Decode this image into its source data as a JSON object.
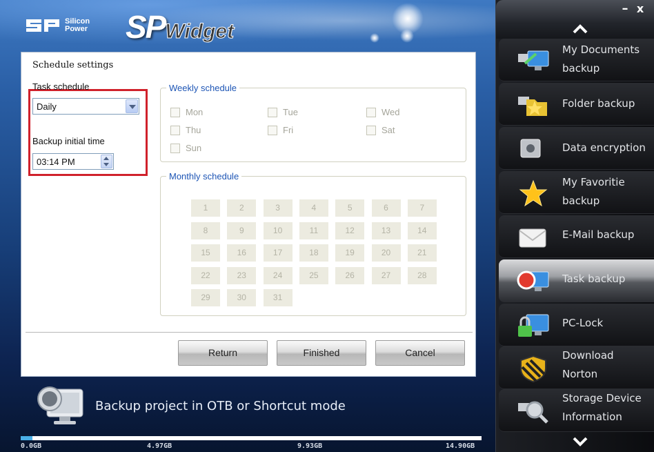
{
  "brand": {
    "company": "Silicon\nPower",
    "company_line1": "Silicon",
    "company_line2": "Power",
    "app_big": "SP",
    "app_small": "Widget"
  },
  "window_controls": {
    "minimize": "–",
    "close": "x"
  },
  "panel": {
    "title": "Schedule settings",
    "task_schedule_label": "Task schedule",
    "task_schedule_value": "Daily",
    "backup_time_label": "Backup initial time",
    "backup_time_value": "03:14 PM",
    "weekly_legend": "Weekly schedule",
    "weekly_days": [
      "Mon",
      "Tue",
      "Wed",
      "Thu",
      "Fri",
      "Sat",
      "Sun"
    ],
    "monthly_legend": "Monthly schedule",
    "monthly_days": [
      "1",
      "2",
      "3",
      "4",
      "5",
      "6",
      "7",
      "8",
      "9",
      "10",
      "11",
      "12",
      "13",
      "14",
      "15",
      "16",
      "17",
      "18",
      "19",
      "20",
      "21",
      "22",
      "23",
      "24",
      "25",
      "26",
      "27",
      "28",
      "29",
      "30",
      "31"
    ],
    "buttons": {
      "return": "Return",
      "finished": "Finished",
      "cancel": "Cancel"
    }
  },
  "footer": {
    "message": "Backup project in OTB or Shortcut mode",
    "storage_labels": [
      "0.0GB",
      "4.97GB",
      "9.93GB",
      "14.90GB"
    ],
    "storage_used_fraction": 0.025
  },
  "sidebar": {
    "items": [
      {
        "line1": "My Documents",
        "line2": "backup",
        "icon": "documents-monitor-icon"
      },
      {
        "line1": "Folder backup",
        "line2": "",
        "icon": "folder-star-icon"
      },
      {
        "line1": "Data encryption",
        "line2": "",
        "icon": "safe-icon"
      },
      {
        "line1": "My Favoritie",
        "line2": "backup",
        "icon": "star-icon"
      },
      {
        "line1": "E-Mail backup",
        "line2": "",
        "icon": "envelope-icon"
      },
      {
        "line1": "Task backup",
        "line2": "",
        "icon": "task-monitor-icon",
        "active": true
      },
      {
        "line1": "PC-Lock",
        "line2": "",
        "icon": "lock-monitor-icon"
      },
      {
        "line1": "Download",
        "line2": "Norton",
        "icon": "norton-shield-icon"
      },
      {
        "line1": "Storage Device",
        "line2": "Information",
        "icon": "magnifier-device-icon"
      }
    ]
  },
  "colors": {
    "highlight": "#d0212b",
    "legend": "#1d55b5",
    "active_item": "#9ea0a4",
    "storage_fill": "#4ab0e8"
  }
}
